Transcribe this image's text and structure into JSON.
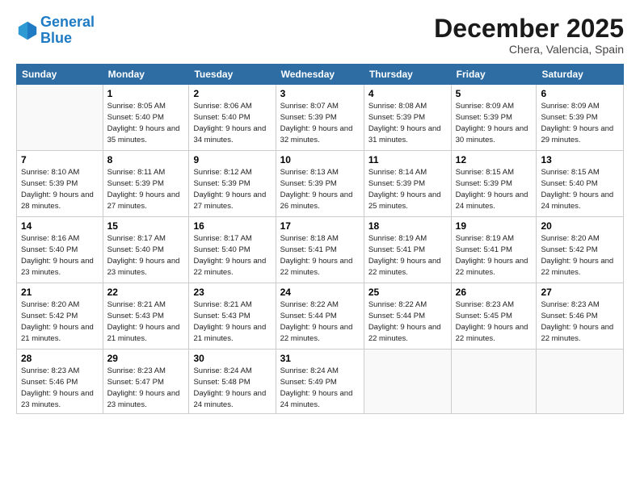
{
  "header": {
    "logo_line1": "General",
    "logo_line2": "Blue",
    "month": "December 2025",
    "location": "Chera, Valencia, Spain"
  },
  "days_of_week": [
    "Sunday",
    "Monday",
    "Tuesday",
    "Wednesday",
    "Thursday",
    "Friday",
    "Saturday"
  ],
  "weeks": [
    [
      {
        "num": "",
        "empty": true
      },
      {
        "num": "1",
        "rise": "8:05 AM",
        "set": "5:40 PM",
        "daylight": "9 hours and 35 minutes."
      },
      {
        "num": "2",
        "rise": "8:06 AM",
        "set": "5:40 PM",
        "daylight": "9 hours and 34 minutes."
      },
      {
        "num": "3",
        "rise": "8:07 AM",
        "set": "5:39 PM",
        "daylight": "9 hours and 32 minutes."
      },
      {
        "num": "4",
        "rise": "8:08 AM",
        "set": "5:39 PM",
        "daylight": "9 hours and 31 minutes."
      },
      {
        "num": "5",
        "rise": "8:09 AM",
        "set": "5:39 PM",
        "daylight": "9 hours and 30 minutes."
      },
      {
        "num": "6",
        "rise": "8:09 AM",
        "set": "5:39 PM",
        "daylight": "9 hours and 29 minutes."
      }
    ],
    [
      {
        "num": "7",
        "rise": "8:10 AM",
        "set": "5:39 PM",
        "daylight": "9 hours and 28 minutes."
      },
      {
        "num": "8",
        "rise": "8:11 AM",
        "set": "5:39 PM",
        "daylight": "9 hours and 27 minutes."
      },
      {
        "num": "9",
        "rise": "8:12 AM",
        "set": "5:39 PM",
        "daylight": "9 hours and 27 minutes."
      },
      {
        "num": "10",
        "rise": "8:13 AM",
        "set": "5:39 PM",
        "daylight": "9 hours and 26 minutes."
      },
      {
        "num": "11",
        "rise": "8:14 AM",
        "set": "5:39 PM",
        "daylight": "9 hours and 25 minutes."
      },
      {
        "num": "12",
        "rise": "8:15 AM",
        "set": "5:39 PM",
        "daylight": "9 hours and 24 minutes."
      },
      {
        "num": "13",
        "rise": "8:15 AM",
        "set": "5:40 PM",
        "daylight": "9 hours and 24 minutes."
      }
    ],
    [
      {
        "num": "14",
        "rise": "8:16 AM",
        "set": "5:40 PM",
        "daylight": "9 hours and 23 minutes."
      },
      {
        "num": "15",
        "rise": "8:17 AM",
        "set": "5:40 PM",
        "daylight": "9 hours and 23 minutes."
      },
      {
        "num": "16",
        "rise": "8:17 AM",
        "set": "5:40 PM",
        "daylight": "9 hours and 22 minutes."
      },
      {
        "num": "17",
        "rise": "8:18 AM",
        "set": "5:41 PM",
        "daylight": "9 hours and 22 minutes."
      },
      {
        "num": "18",
        "rise": "8:19 AM",
        "set": "5:41 PM",
        "daylight": "9 hours and 22 minutes."
      },
      {
        "num": "19",
        "rise": "8:19 AM",
        "set": "5:41 PM",
        "daylight": "9 hours and 22 minutes."
      },
      {
        "num": "20",
        "rise": "8:20 AM",
        "set": "5:42 PM",
        "daylight": "9 hours and 22 minutes."
      }
    ],
    [
      {
        "num": "21",
        "rise": "8:20 AM",
        "set": "5:42 PM",
        "daylight": "9 hours and 21 minutes."
      },
      {
        "num": "22",
        "rise": "8:21 AM",
        "set": "5:43 PM",
        "daylight": "9 hours and 21 minutes."
      },
      {
        "num": "23",
        "rise": "8:21 AM",
        "set": "5:43 PM",
        "daylight": "9 hours and 21 minutes."
      },
      {
        "num": "24",
        "rise": "8:22 AM",
        "set": "5:44 PM",
        "daylight": "9 hours and 22 minutes."
      },
      {
        "num": "25",
        "rise": "8:22 AM",
        "set": "5:44 PM",
        "daylight": "9 hours and 22 minutes."
      },
      {
        "num": "26",
        "rise": "8:23 AM",
        "set": "5:45 PM",
        "daylight": "9 hours and 22 minutes."
      },
      {
        "num": "27",
        "rise": "8:23 AM",
        "set": "5:46 PM",
        "daylight": "9 hours and 22 minutes."
      }
    ],
    [
      {
        "num": "28",
        "rise": "8:23 AM",
        "set": "5:46 PM",
        "daylight": "9 hours and 23 minutes."
      },
      {
        "num": "29",
        "rise": "8:23 AM",
        "set": "5:47 PM",
        "daylight": "9 hours and 23 minutes."
      },
      {
        "num": "30",
        "rise": "8:24 AM",
        "set": "5:48 PM",
        "daylight": "9 hours and 24 minutes."
      },
      {
        "num": "31",
        "rise": "8:24 AM",
        "set": "5:49 PM",
        "daylight": "9 hours and 24 minutes."
      },
      {
        "num": "",
        "empty": true
      },
      {
        "num": "",
        "empty": true
      },
      {
        "num": "",
        "empty": true
      }
    ]
  ]
}
